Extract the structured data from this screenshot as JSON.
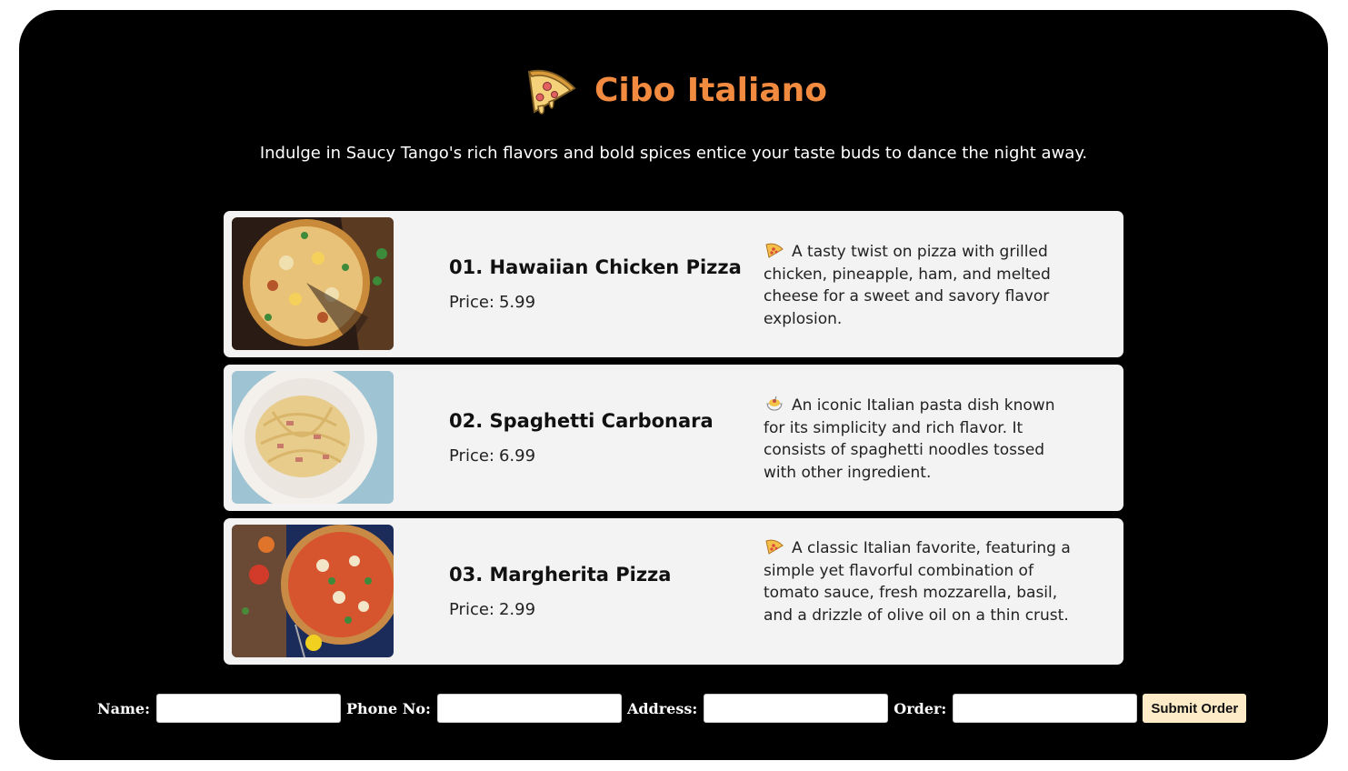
{
  "header": {
    "logo_icon": "pizza-slice-icon",
    "title": "Cibo Italiano",
    "title_color": "#f28a3f",
    "tagline": "Indulge in Saucy Tango's rich flavors and bold spices entice your taste buds to dance the night away."
  },
  "menu": {
    "items": [
      {
        "name": "01. Hawaiian Chicken Pizza",
        "price_label": "Price:",
        "price": "5.99",
        "emoji": "pizza-icon",
        "description": "A tasty twist on pizza with grilled chicken, pineapple, ham, and melted cheese for a sweet and savory flavor explosion."
      },
      {
        "name": "02. Spaghetti Carbonara",
        "price_label": "Price:",
        "price": "6.99",
        "emoji": "spaghetti-icon",
        "description": "An iconic Italian pasta dish known for its simplicity and rich flavor. It consists of spaghetti noodles tossed with other ingredient."
      },
      {
        "name": "03. Margherita Pizza",
        "price_label": "Price:",
        "price": "2.99",
        "emoji": "pizza-icon",
        "description": "A classic Italian favorite, featuring a simple yet flavorful combination of tomato sauce, fresh mozzarella, basil, and a drizzle of olive oil on a thin crust."
      }
    ]
  },
  "order_form": {
    "name_label": "Name:",
    "name_value": "",
    "phone_label": "Phone No:",
    "phone_value": "",
    "address_label": "Address:",
    "address_value": "",
    "order_label": "Order:",
    "order_value": "",
    "submit_label": "Submit Order"
  },
  "colors": {
    "background": "#000000",
    "card_background": "#f3f3f3",
    "submit_background": "#fdebc8"
  }
}
